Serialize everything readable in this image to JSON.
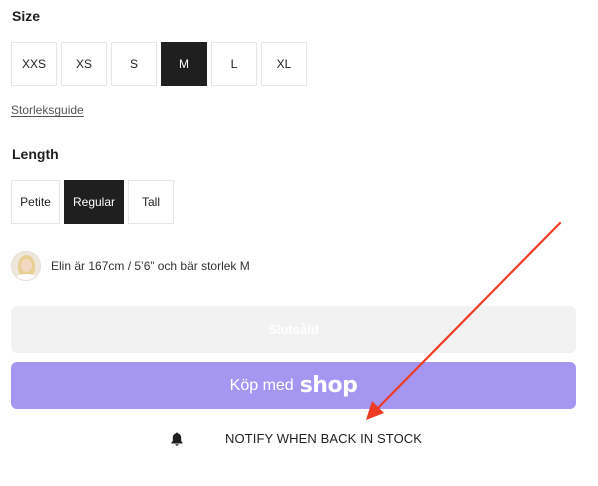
{
  "size": {
    "title": "Size",
    "options": [
      {
        "label": "XXS",
        "selected": false
      },
      {
        "label": "XS",
        "selected": false
      },
      {
        "label": "S",
        "selected": false
      },
      {
        "label": "M",
        "selected": true
      },
      {
        "label": "L",
        "selected": false
      },
      {
        "label": "XL",
        "selected": false
      }
    ],
    "guide_link": "Storleksguide"
  },
  "length": {
    "title": "Length",
    "options": [
      {
        "label": "Petite",
        "selected": false
      },
      {
        "label": "Regular",
        "selected": true
      },
      {
        "label": "Tall",
        "selected": false
      }
    ]
  },
  "model_info": {
    "text": "Elin är 167cm / 5’6” och bär storlek M"
  },
  "buttons": {
    "sold_out": "Slutsåld",
    "shop_pay_prefix": "Köp med",
    "shop_pay_brand": "shop",
    "notify": "NOTIFY WHEN BACK IN STOCK"
  },
  "icons": {
    "notify": "bell-icon",
    "annotation": "red-arrow"
  },
  "colors": {
    "selected_bg": "#1f1f1f",
    "shop_button": "#a596f2",
    "sold_out_button": "#f2f2f2",
    "annotation_arrow": "#ee3b24"
  }
}
